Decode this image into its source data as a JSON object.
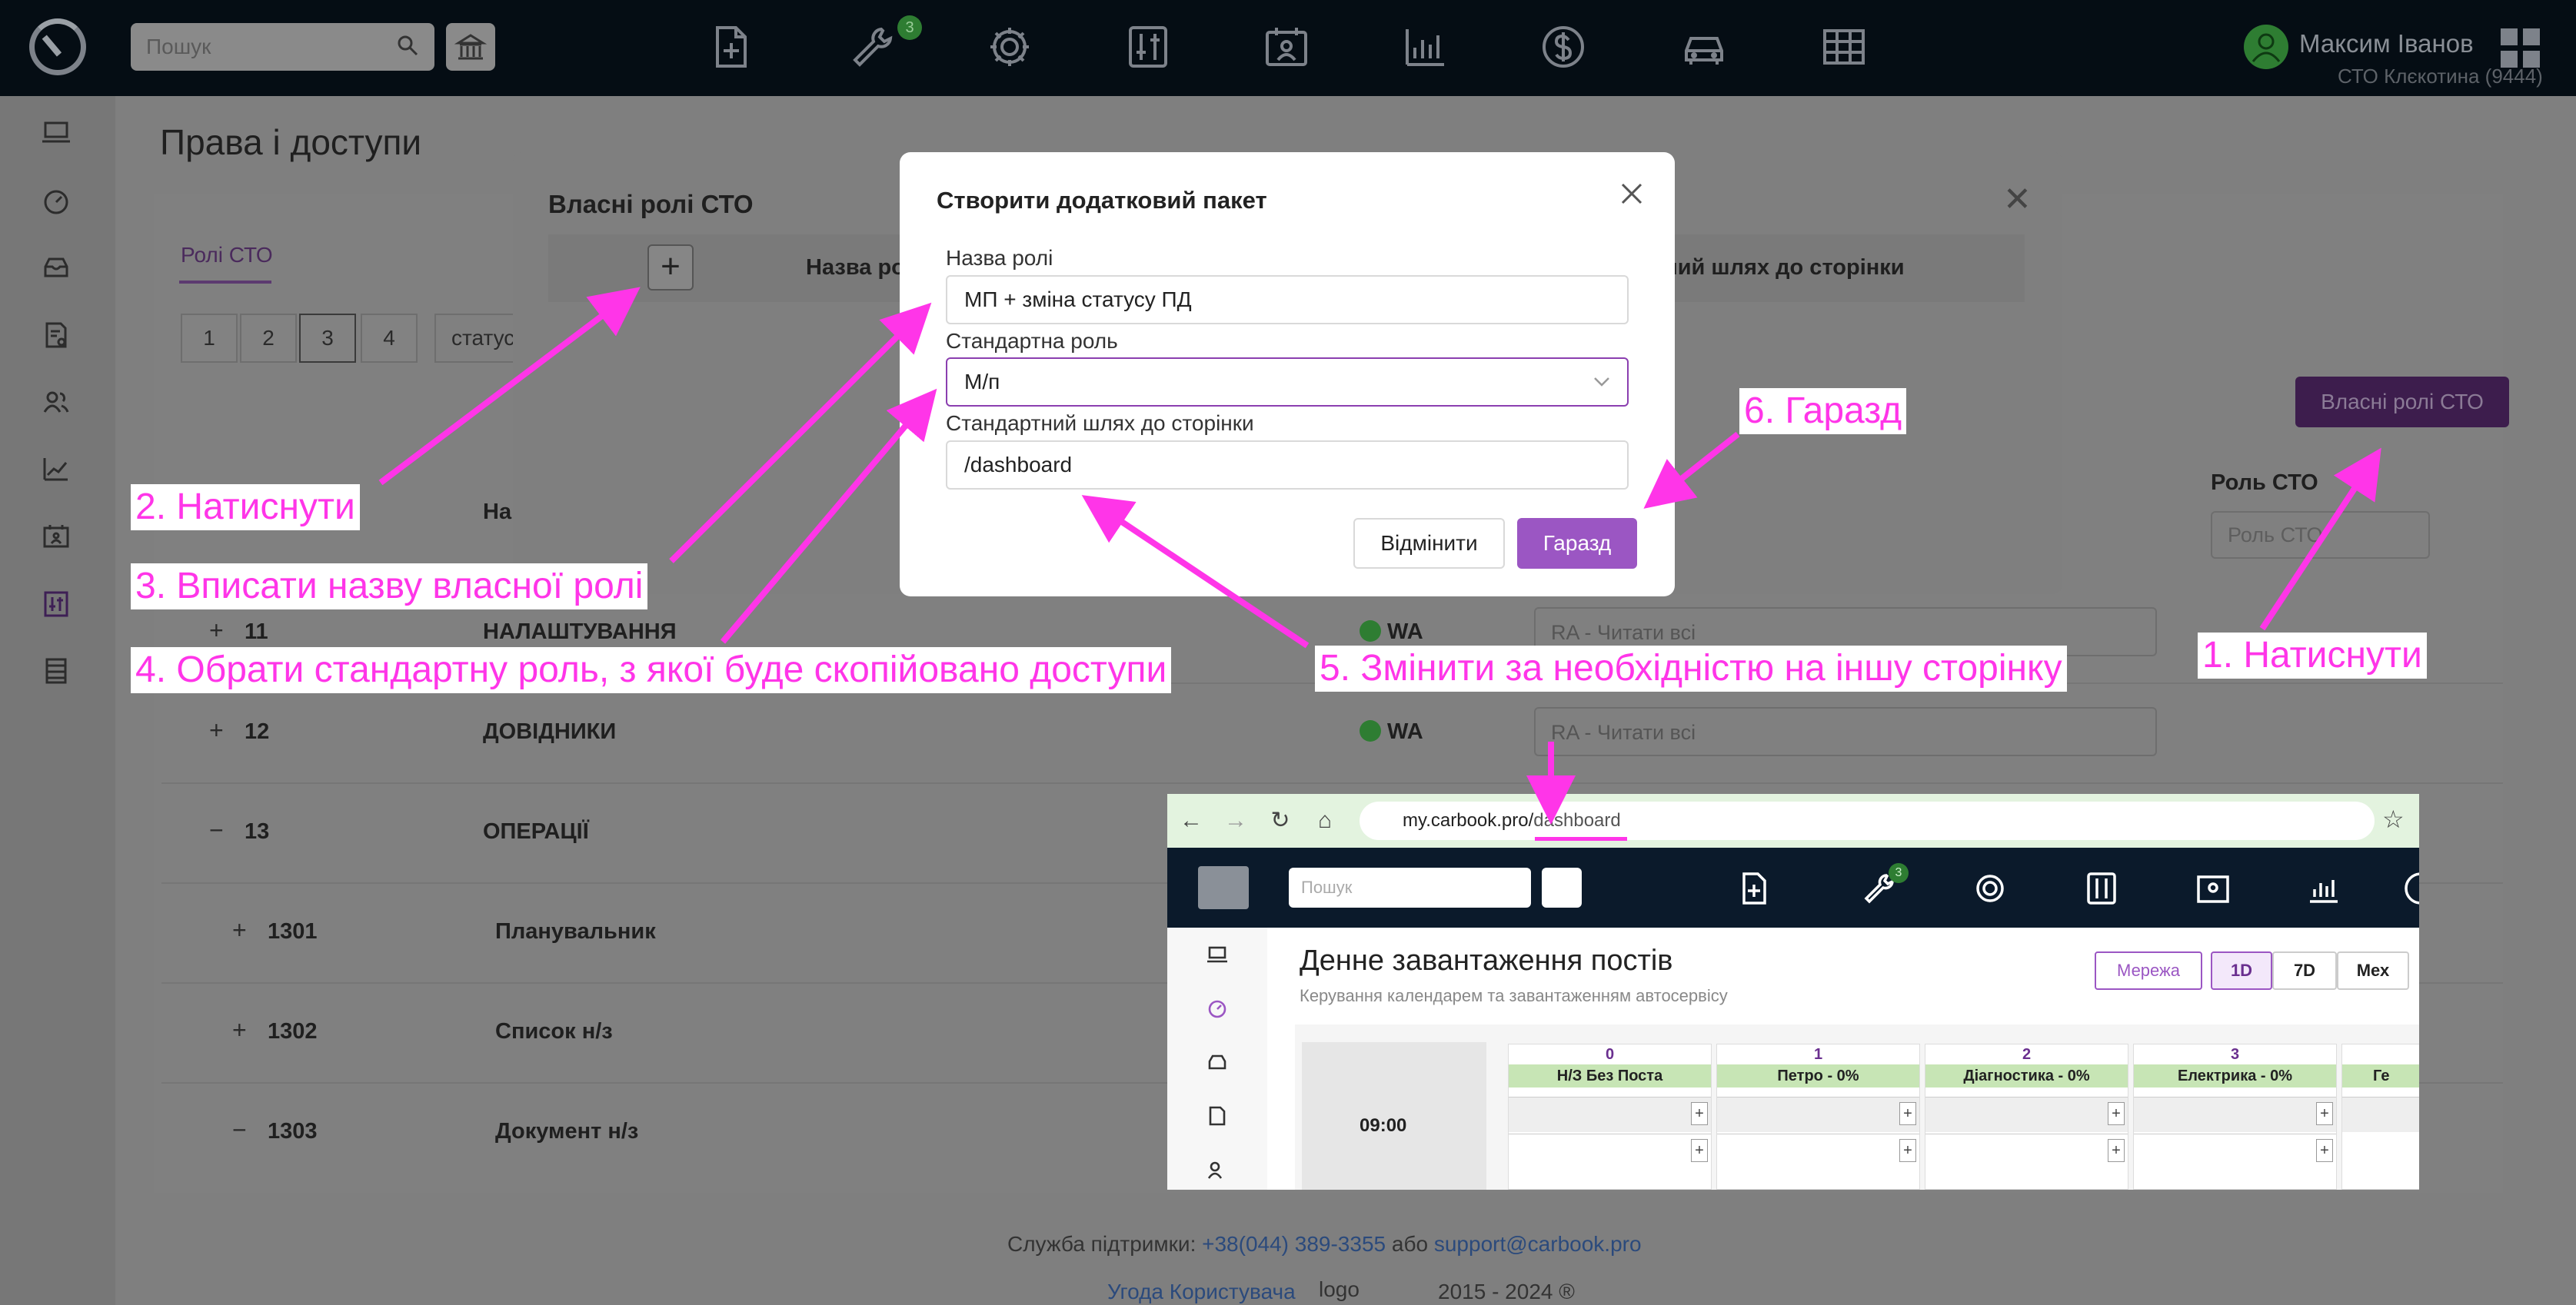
{
  "topbar": {
    "search_placeholder": "Пошук",
    "badge": "3",
    "user_name": "Максим Іванов",
    "user_station": "СТО Клєкотина (9444)",
    "icons": [
      "new-document-icon",
      "wrench-icon",
      "settings-gear-icon",
      "sliders-icon",
      "calendar-user-icon",
      "bar-chart-icon",
      "dollar-icon",
      "car-icon",
      "table-icon"
    ]
  },
  "page": {
    "title": "Права і доступи",
    "tab_roles": "Ролі СТО",
    "pages": [
      "1",
      "2",
      "3",
      "4"
    ],
    "status_filter": "статус",
    "own_roles_button": "Власні ролі СТО",
    "col_name": "На",
    "col_role": "Роль СТО",
    "role_select_placeholder": "Роль СТО",
    "rows": [
      {
        "expand": "+",
        "code": "11",
        "name": "НАЛАШТУВАННЯ",
        "access": "WA",
        "select": "RA - Читати всі"
      },
      {
        "expand": "+",
        "code": "12",
        "name": "ДОВІДНИКИ",
        "access": "WA",
        "select": "RA - Читати всі"
      },
      {
        "expand": "−",
        "code": "13",
        "name": "ОПЕРАЦІЇ",
        "access": "",
        "select": ""
      },
      {
        "expand": "+",
        "code": "1301",
        "name": "Планувальник",
        "access": "",
        "select": ""
      },
      {
        "expand": "+",
        "code": "1302",
        "name": "Список н/з",
        "access": "",
        "select": ""
      },
      {
        "expand": "−",
        "code": "1303",
        "name": "Документ н/з",
        "access": "",
        "select": ""
      }
    ]
  },
  "footer": {
    "support_label": "Служба підтримки:",
    "phone": "+38(044) 389-3355",
    "or": "або",
    "email": "support@carbook.pro",
    "agreement": "Угода Користувача",
    "logo_alt": "logo",
    "years": "2015 - 2024 ®"
  },
  "own_roles_modal": {
    "title": "Власні ролі СТО",
    "add": "+",
    "col_name": "Назва ро",
    "col_path": "тний шлях до сторінки"
  },
  "dialog": {
    "title": "Створити додатковий пакет",
    "name_label": "Назва ролі",
    "name_value": "МП + зміна статусу ПД",
    "std_role_label": "Стандартна роль",
    "std_role_value": "М/п",
    "path_label": "Стандартний шлях до сторінки",
    "path_value": "/dashboard",
    "cancel": "Відмінити",
    "ok": "Гаразд"
  },
  "annotations": {
    "a1": "1. Натиснути",
    "a2": "2. Натиснути",
    "a3": "3. Вписати назву власної ролі",
    "a4": "4. Обрати стандартну роль, з якої буде скопійовано доступи",
    "a5": "5. Змінити за необхідністю на іншу сторінку",
    "a6": "6. Гаразд",
    "color": "#ff35e8"
  },
  "inset": {
    "url_host": "my.carbook.pro/",
    "url_path": "dashboard",
    "search_placeholder": "Пошук",
    "badge": "3",
    "title": "Денне завантаження постів",
    "subtitle": "Керування календарем та завантаженням автосервісу",
    "btn_net": "Мережа",
    "btn_1d": "1D",
    "btn_7d": "7D",
    "btn_mex": "Мех",
    "time": "09:00",
    "columns": [
      {
        "num": "0",
        "head": "Н/З Без Поста"
      },
      {
        "num": "1",
        "head": "Петро - 0%"
      },
      {
        "num": "2",
        "head": "Діагностика - 0%"
      },
      {
        "num": "3",
        "head": "Електрика - 0%"
      },
      {
        "num": "",
        "head": "Ге"
      }
    ]
  }
}
